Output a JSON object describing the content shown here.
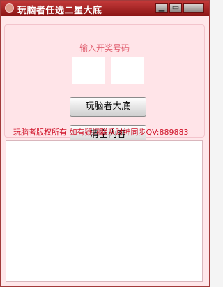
{
  "window": {
    "title": "玩脑者任选二星大底",
    "controls": {
      "minimize_icon": "minimize-icon",
      "maximize_icon": "maximize-icon",
      "close_icon": "close-icon"
    }
  },
  "group": {
    "legend": "输入开奖号码",
    "inputs": [
      "",
      ""
    ]
  },
  "buttons": {
    "draw_label": "玩脑者大底",
    "clear_label": "清空内容"
  },
  "footer": {
    "text": "玩脑者版权所有 如有疑问联系财神同步QV:889883"
  },
  "output": {
    "value": ""
  },
  "colors": {
    "accent": "#d0142a",
    "titlebar": "#a32020",
    "background": "#ffe7ea"
  }
}
